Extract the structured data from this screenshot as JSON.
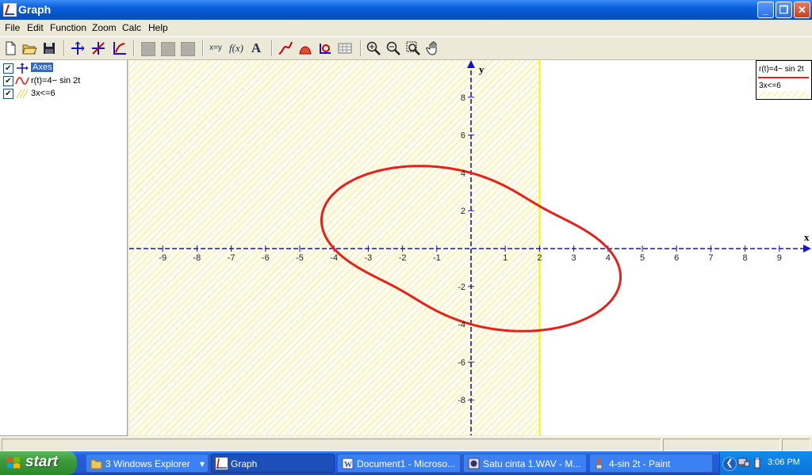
{
  "window": {
    "title": "Graph",
    "minimize": "_",
    "restore": "❐",
    "close": "✕"
  },
  "menu": [
    "File",
    "Edit",
    "Function",
    "Zoom",
    "Calc",
    "Help"
  ],
  "toolbar": {
    "icons": [
      "new-icon",
      "open-icon",
      "save-icon",
      "insert-axes-icon",
      "insert-tangent-icon",
      "insert-normal-icon",
      "disabled-icon",
      "disabled-icon",
      "disabled-icon",
      "swap-xy-icon",
      "insert-function-icon",
      "insert-text-icon",
      "insert-series-icon",
      "insert-shading-icon",
      "relation-icon",
      "table-icon",
      "zoom-in-icon",
      "zoom-out-icon",
      "zoom-window-icon",
      "pan-hand-icon"
    ],
    "xy_label": "x=y",
    "fx_label": "f(x)",
    "text_label": "A"
  },
  "panel": {
    "items": [
      {
        "label": "Axes",
        "checked": "✔",
        "selected": true
      },
      {
        "label": "r(t)=4− sin 2t",
        "checked": "✔"
      },
      {
        "label": "3x<=6",
        "checked": "✔"
      }
    ]
  },
  "legend": {
    "curve": "r(t)=4− sin 2t",
    "shading": "3x<=6"
  },
  "chart_data": {
    "type": "line",
    "xlabel": "x",
    "ylabel": "y",
    "xlim": [
      -9.9,
      10
    ],
    "ylim": [
      -9.7,
      9.7
    ],
    "x_ticks": [
      -9,
      -8,
      -7,
      -6,
      -5,
      -4,
      -3,
      -2,
      -1,
      1,
      2,
      3,
      4,
      5,
      6,
      7,
      8,
      9
    ],
    "y_ticks": [
      -8,
      -6,
      -4,
      -2,
      2,
      4,
      6,
      8
    ],
    "x_tick_labels": [
      "-9",
      "-8",
      "-7",
      "-6",
      "-5",
      "-4",
      "-3",
      "-2",
      "-1",
      "1",
      "2",
      "3",
      "4",
      "5",
      "6",
      "7",
      "8",
      "9"
    ],
    "y_tick_labels": [
      "-8",
      "-6",
      "-4",
      "-2",
      "2",
      "4",
      "6",
      "8"
    ],
    "grid": false,
    "legend_position": "top-right",
    "series": [
      {
        "name": "r(t)=4− sin 2t",
        "polar": "r = 4 - sin(2t)",
        "color": "#e8201a"
      }
    ],
    "shading": {
      "name": "3x<=6",
      "region": "x <= 2",
      "color": "#ffe040",
      "boundary_color": "#ffee00"
    },
    "axis_color": "#1414cc"
  },
  "statusbar": {
    "cells": [
      "",
      "",
      ""
    ]
  },
  "taskbar": {
    "start": "start",
    "tasks": [
      {
        "label": "3 Windows Explorer",
        "icon": "folder-icon",
        "dropdown": "▾"
      },
      {
        "label": "Graph",
        "icon": "graph-icon",
        "active": true
      },
      {
        "label": "Document1 - Microso...",
        "icon": "word-icon"
      },
      {
        "label": "Satu cinta 1.WAV - M...",
        "icon": "media-icon"
      },
      {
        "label": "4-sin 2t - Paint",
        "icon": "paint-icon"
      }
    ],
    "tray_chevron": "❮",
    "clock": "3:06 PM"
  }
}
